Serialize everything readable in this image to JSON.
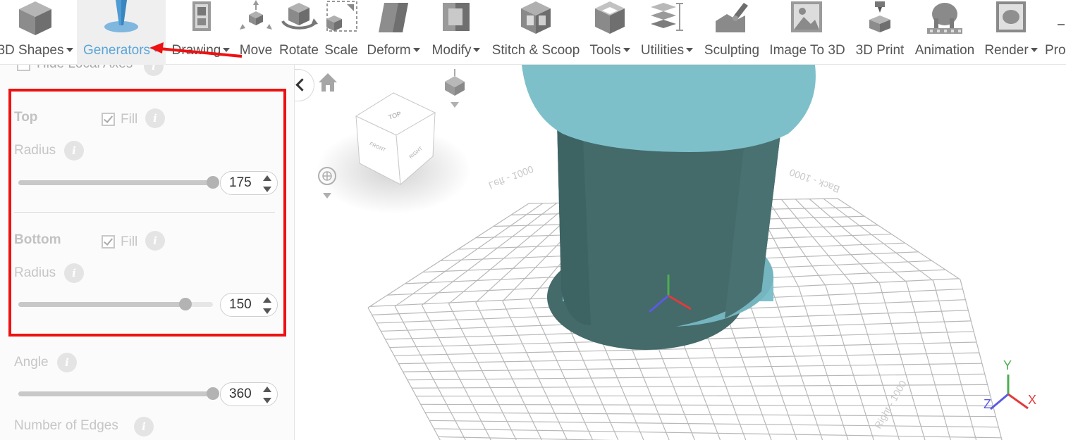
{
  "toolbar": {
    "items": [
      {
        "label": "3D Shapes",
        "icon": "cube-icon",
        "dropdown": true
      },
      {
        "label": "Generators",
        "icon": "generator-icon",
        "dropdown": true,
        "active": true
      },
      {
        "label": "Drawing",
        "icon": "drawing-icon",
        "dropdown": true
      },
      {
        "label": "Move",
        "icon": "move-icon",
        "dropdown": false
      },
      {
        "label": "Rotate",
        "icon": "rotate-icon",
        "dropdown": false
      },
      {
        "label": "Scale",
        "icon": "scale-icon",
        "dropdown": false
      },
      {
        "label": "Deform",
        "icon": "deform-icon",
        "dropdown": true
      },
      {
        "label": "Modify",
        "icon": "modify-icon",
        "dropdown": true
      },
      {
        "label": "Stitch & Scoop",
        "icon": "stitch-scoop-icon",
        "dropdown": false
      },
      {
        "label": "Tools",
        "icon": "tools-icon",
        "dropdown": true
      },
      {
        "label": "Utilities",
        "icon": "utilities-icon",
        "dropdown": true
      },
      {
        "label": "Sculpting",
        "icon": "sculpting-icon",
        "dropdown": false
      },
      {
        "label": "Image To 3D",
        "icon": "image-to-3d-icon",
        "dropdown": false
      },
      {
        "label": "3D Print",
        "icon": "3d-print-icon",
        "dropdown": false
      },
      {
        "label": "Animation",
        "icon": "animation-icon",
        "dropdown": false
      },
      {
        "label": "Render",
        "icon": "render-icon",
        "dropdown": true
      },
      {
        "label": "Pro",
        "icon": "pro-icon",
        "dropdown": false
      }
    ]
  },
  "panel": {
    "hidden_top_label": "Hide Local Axes",
    "top": {
      "heading": "Top",
      "fill_label": "Fill",
      "fill_checked": true,
      "radius_label": "Radius",
      "radius_value": "175",
      "radius_fraction": 1.0
    },
    "bottom": {
      "heading": "Bottom",
      "fill_label": "Fill",
      "fill_checked": true,
      "radius_label": "Radius",
      "radius_value": "150",
      "radius_fraction": 0.857
    },
    "angle": {
      "label": "Angle",
      "value": "360",
      "fraction": 1.0
    },
    "edges_label": "Number of Edges"
  },
  "viewcube": {
    "top_face": "TOP",
    "front_face": "FRONT",
    "right_face": "RIGHT"
  },
  "axis_triad": {
    "x": "X",
    "y": "Y",
    "z": "Z"
  },
  "grid_labels": [
    "Left - 1000",
    "Back - 1000",
    "Right - 1000"
  ],
  "colors": {
    "accent": "#5aa6d8",
    "highlight_box": "#ee1111",
    "annotation_arrow": "#ee1111",
    "cylinder_body": "#446a6a",
    "cylinder_cap": "#7ec0ca",
    "axis_x": "#e33b3b",
    "axis_y": "#4caf50",
    "axis_z": "#5b5be0"
  }
}
